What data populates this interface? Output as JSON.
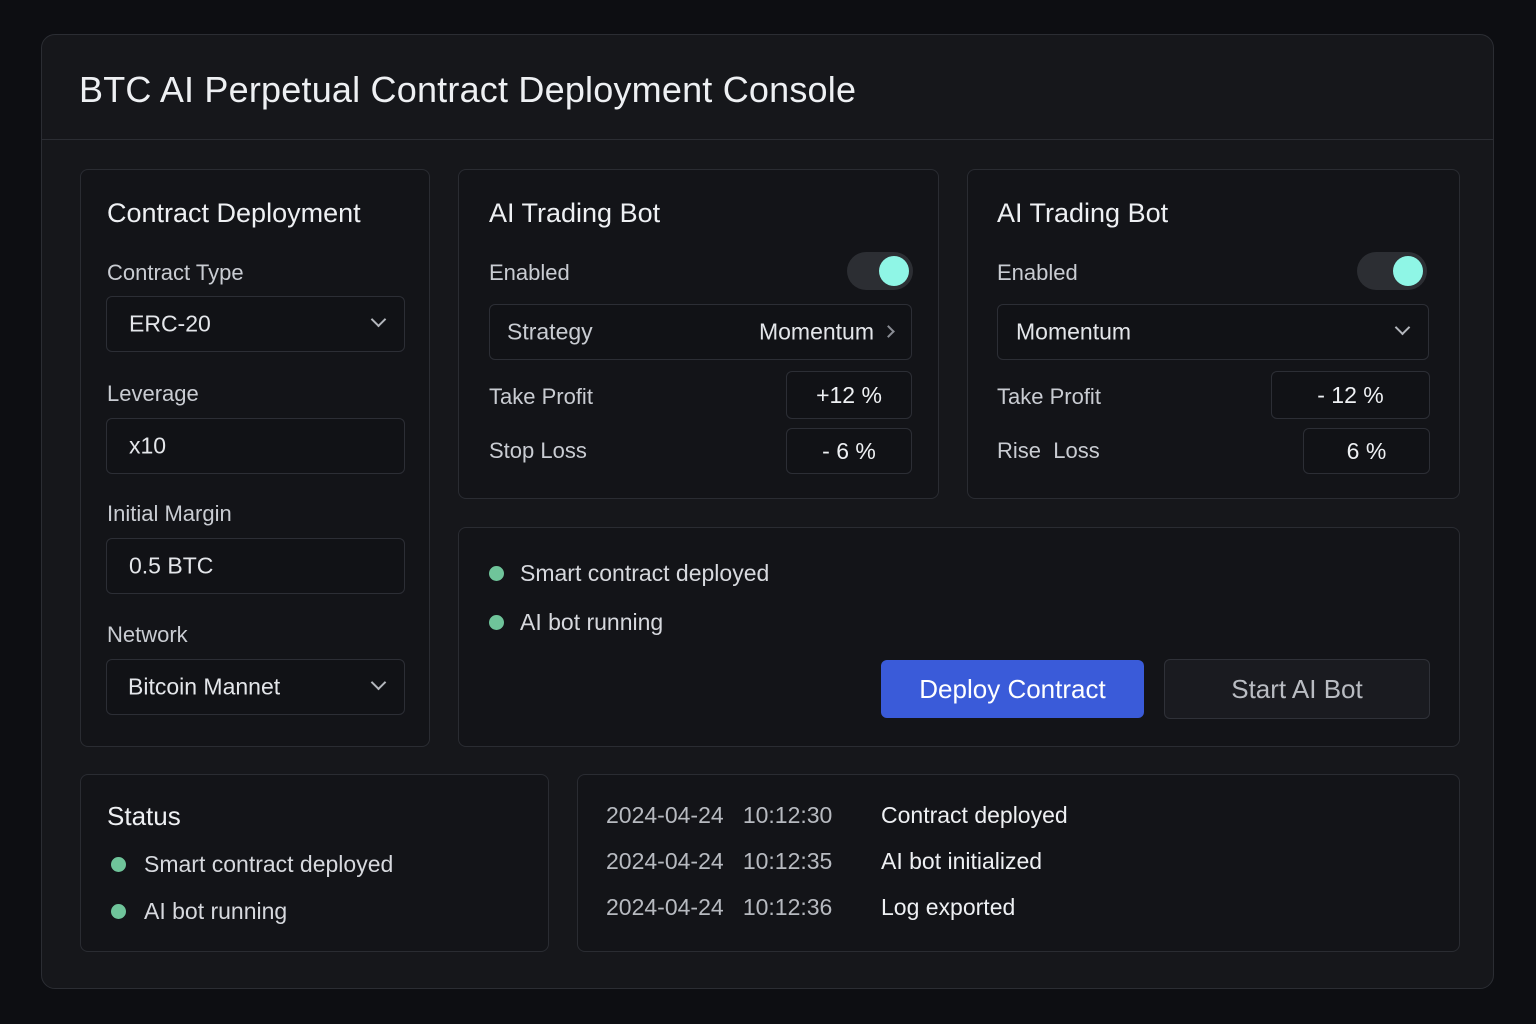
{
  "window": {
    "title": "BTC AI Perpetual Contract Deployment Console"
  },
  "deployment": {
    "title": "Contract Deployment",
    "contract_type": {
      "label": "Contract Type",
      "value": "ERC-20"
    },
    "leverage": {
      "label": "Leverage",
      "value": "x10"
    },
    "initial_margin": {
      "label": "Initial Margin",
      "value": "0.5 BTC"
    },
    "network": {
      "label": "Network",
      "value": "Bitcoin Mannet"
    }
  },
  "bot1": {
    "title": "AI Trading Bot",
    "enabled_label": "Enabled",
    "enabled": true,
    "strategy_label": "Strategy",
    "strategy_value": "Momentum",
    "take_profit_label": "Take Profit",
    "take_profit_value": "+12 %",
    "stop_loss_label": "Stop Loss",
    "stop_loss_value": "- 6 %"
  },
  "bot2": {
    "title": "AI Trading Bot",
    "enabled_label": "Enabled",
    "enabled": true,
    "strategy_value": "Momentum",
    "take_profit_label": "Take Profit",
    "take_profit_value": "- 12 %",
    "rise_loss_label": "Rise  Loss",
    "rise_loss_value": "6 %"
  },
  "actions": {
    "status_items": [
      "Smart contract deployed",
      "AI bot running"
    ],
    "deploy_label": "Deploy Contract",
    "start_label": "Start AI Bot"
  },
  "status": {
    "title": "Status",
    "items": [
      "Smart contract deployed",
      "AI bot running"
    ]
  },
  "log": [
    {
      "timestamp": "2024-04-24   10:12:30",
      "message": "Contract deployed"
    },
    {
      "timestamp": "2024-04-24   10:12:35",
      "message": "AI bot initialized"
    },
    {
      "timestamp": "2024-04-24   10:12:36",
      "message": "Log exported"
    }
  ],
  "colors": {
    "accent": "#3a5bd9",
    "toggle_knob": "#8ff6e6",
    "status_ok": "#6fc49a",
    "background": "#0d0e12"
  }
}
